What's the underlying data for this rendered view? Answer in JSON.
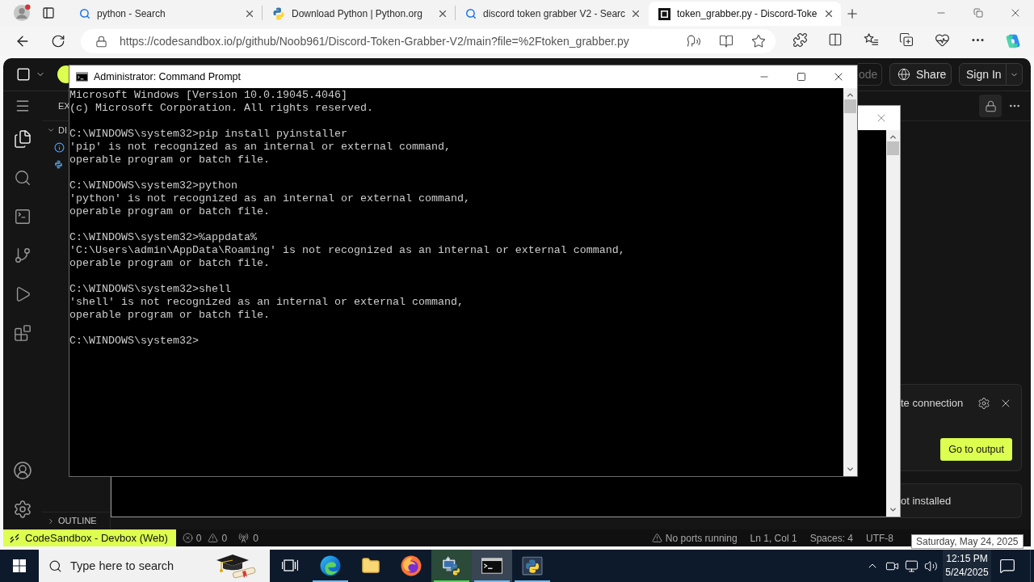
{
  "browser": {
    "tabs": [
      {
        "title": "python - Search",
        "kind": "search",
        "selected": false
      },
      {
        "title": "Download Python | Python.org",
        "kind": "python",
        "selected": false
      },
      {
        "title": "discord token grabber V2 - Searc",
        "kind": "search",
        "selected": false
      },
      {
        "title": "token_grabber.py - Discord-Toke",
        "kind": "sandbox",
        "selected": true
      }
    ],
    "address": "https://codesandbox.io/p/github/Noob961/Discord-Token-Grabber-V2/main?file=%2Ftoken_grabber.py"
  },
  "sandbox": {
    "top_bar": {
      "partial_button": "ode",
      "share": "Share",
      "sign_in": "Sign In"
    },
    "explorer": {
      "title": "EX",
      "folder": "DI",
      "outline": "OUTLINE"
    },
    "notifications": [
      {
        "message": "te connection",
        "action": "Go to output"
      },
      {
        "message": "ot installed"
      }
    ],
    "status_bar": {
      "remote": "CodeSandbox - Devbox (Web)",
      "errors": "0",
      "warnings": "0",
      "ports": "0",
      "ports_status": "No ports running",
      "cursor": "Ln 1, Col 1",
      "indent": "Spaces: 4",
      "encoding": "UTF-8"
    }
  },
  "command_prompt": {
    "title": "Administrator: Command Prompt",
    "blocks": [
      [
        "Microsoft Windows [Version 10.0.19045.4046]",
        "(c) Microsoft Corporation. All rights reserved."
      ],
      [
        "C:\\WINDOWS\\system32>pip install pyinstaller",
        "'pip' is not recognized as an internal or external command,",
        "operable program or batch file."
      ],
      [
        "C:\\WINDOWS\\system32>python",
        "'python' is not recognized as an internal or external command,",
        "operable program or batch file."
      ],
      [
        "C:\\WINDOWS\\system32>%appdata%",
        "'C:\\Users\\admin\\AppData\\Roaming' is not recognized as an internal or external command,",
        "operable program or batch file."
      ],
      [
        "C:\\WINDOWS\\system32>shell",
        "'shell' is not recognized as an internal or external command,",
        "operable program or batch file."
      ],
      [
        "C:\\WINDOWS\\system32>"
      ]
    ]
  },
  "clock_tooltip": "Saturday, May 24, 2025",
  "taskbar": {
    "search": {
      "placeholder": "Type here to search"
    },
    "apps": [
      {
        "kind": "edge",
        "running": true,
        "selected": false,
        "attention": false
      },
      {
        "kind": "folder",
        "running": false,
        "selected": false,
        "attention": false
      },
      {
        "kind": "firefox",
        "running": false,
        "selected": false,
        "attention": false
      },
      {
        "kind": "installer",
        "running": true,
        "selected": false,
        "attention": true
      },
      {
        "kind": "terminal",
        "running": true,
        "selected": true,
        "attention": false
      },
      {
        "kind": "python",
        "running": true,
        "selected": false,
        "attention": false
      }
    ],
    "clock": {
      "time": "12:15 PM",
      "date": "5/24/2025"
    }
  }
}
